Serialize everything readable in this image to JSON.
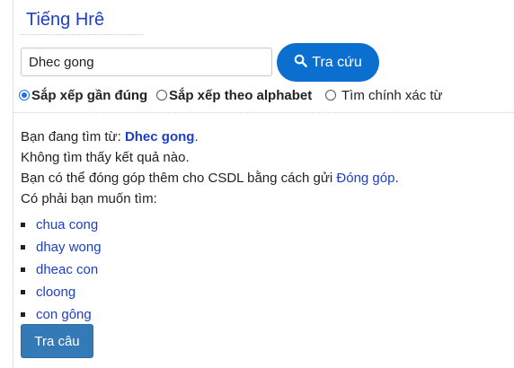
{
  "header": {
    "title": "Tiếng Hrê"
  },
  "search": {
    "value": "Dhec gong",
    "button_label": "Tra cứu",
    "button_icon": "search-icon",
    "button_color": "#0a6fce"
  },
  "sort_options": [
    {
      "label": "Sắp xếp gần đúng",
      "checked": true,
      "bold": true
    },
    {
      "label": "Sắp xếp theo alphabet",
      "checked": false,
      "bold": true
    },
    {
      "label": "Tìm chính xác từ",
      "checked": false,
      "bold": false
    }
  ],
  "results": {
    "searching_prefix": "Bạn đang tìm từ: ",
    "searching_term": "Dhec gong",
    "searching_suffix": ".",
    "not_found": "Không tìm thấy kết quả nào.",
    "contribute_prefix": "Bạn có thể đóng góp thêm cho CSDL bằng cách gửi ",
    "contribute_link": "Đóng góp",
    "contribute_suffix": ".",
    "did_you_mean": "Có phải bạn muốn tìm:"
  },
  "suggestions": [
    "chua cong",
    "dhay wong",
    "dheac con",
    "cloong",
    "con gông"
  ],
  "sentence_button": {
    "label": "Tra câu",
    "color": "#337ab7"
  },
  "colors": {
    "link": "#1d3fc4",
    "title": "#1f3fbf"
  }
}
